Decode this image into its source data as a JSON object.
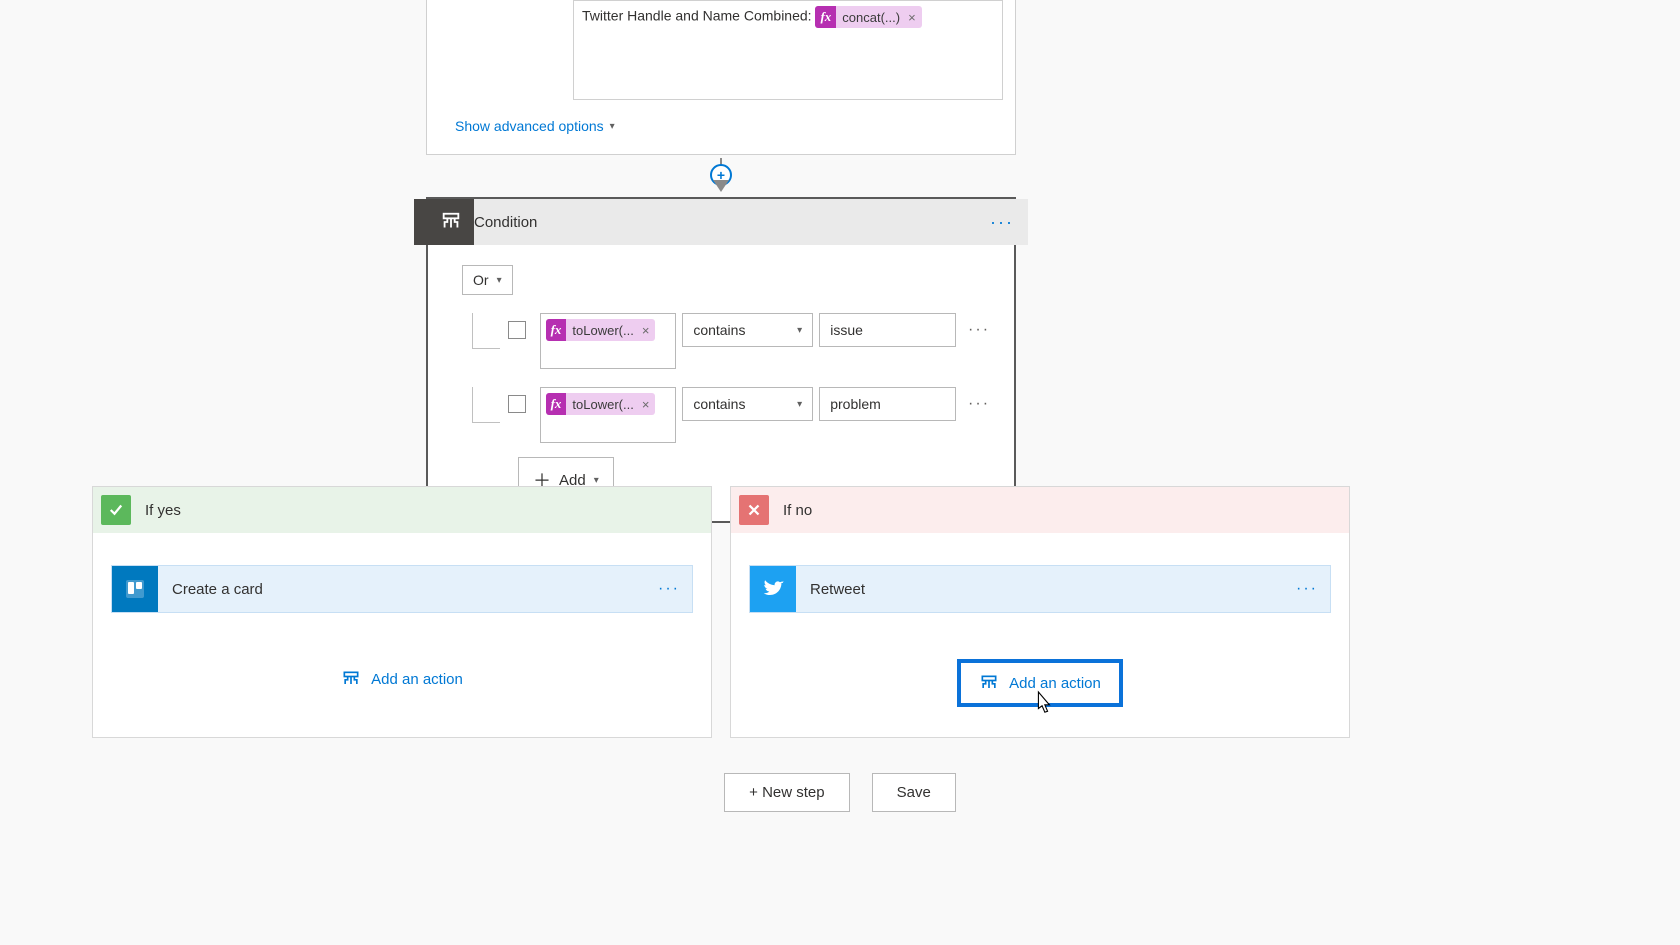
{
  "topCard": {
    "fieldLabel": "Twitter Handle and Name Combined:",
    "expression": "concat(...)",
    "showAdvanced": "Show advanced options"
  },
  "condition": {
    "title": "Condition",
    "group": "Or",
    "rows": [
      {
        "expression": "toLower(...",
        "operator": "contains",
        "value": "issue"
      },
      {
        "expression": "toLower(...",
        "operator": "contains",
        "value": "problem"
      }
    ],
    "addLabel": "Add"
  },
  "branches": {
    "yes": {
      "label": "If yes",
      "action": "Create a card",
      "addAction": "Add an action"
    },
    "no": {
      "label": "If no",
      "action": "Retweet",
      "addAction": "Add an action"
    }
  },
  "bottom": {
    "newStep": "+ New step",
    "save": "Save"
  }
}
